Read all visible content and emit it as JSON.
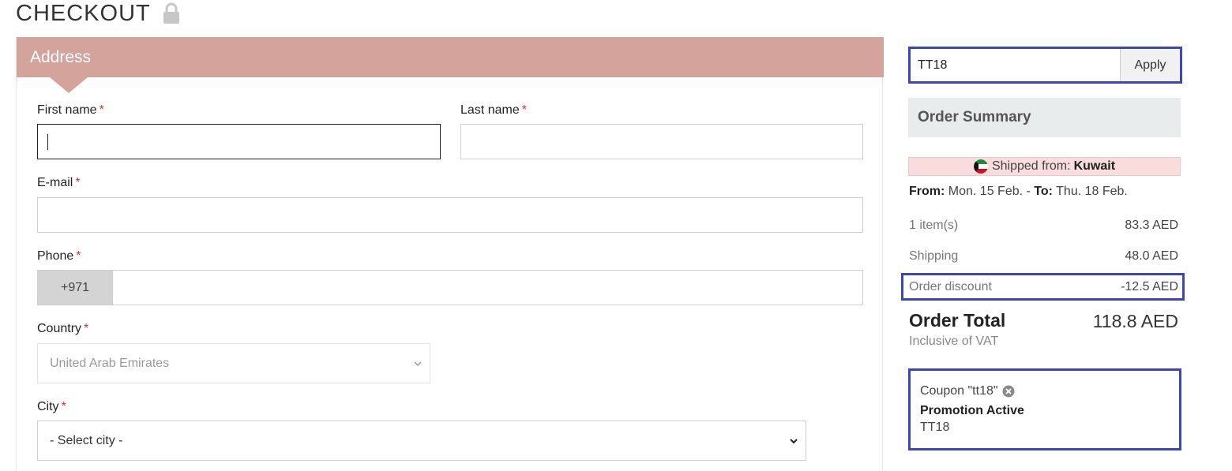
{
  "page": {
    "title": "CHECKOUT",
    "lock_icon": "lock-icon"
  },
  "address": {
    "header": "Address",
    "required_mark": "*",
    "first_name": {
      "label": "First name",
      "value": ""
    },
    "last_name": {
      "label": "Last name",
      "value": ""
    },
    "email": {
      "label": "E-mail",
      "value": ""
    },
    "phone": {
      "label": "Phone",
      "prefix": "+971",
      "value": ""
    },
    "country": {
      "label": "Country",
      "selected": "United Arab Emirates"
    },
    "city": {
      "label": "City",
      "selected": "- Select city -"
    }
  },
  "coupon": {
    "code_value": "TT18",
    "apply_label": "Apply"
  },
  "summary": {
    "header": "Order Summary",
    "shipped_from_label": "Shipped from:",
    "shipped_from_country": "Kuwait",
    "from_label": "From:",
    "from_date": "Mon. 15 Feb.",
    "separator": "-",
    "to_label": "To:",
    "to_date": "Thu. 18 Feb.",
    "items_label": "1 item(s)",
    "items_value": "83.3 AED",
    "shipping_label": "Shipping",
    "shipping_value": "48.0 AED",
    "discount_label": "Order discount",
    "discount_value": "-12.5 AED",
    "total_label": "Order Total",
    "total_value": "118.8 AED",
    "vat_note": "Inclusive of VAT"
  },
  "promotion": {
    "coupon_text": "Coupon \"tt18\"",
    "title": "Promotion Active",
    "code": "TT18"
  },
  "colors": {
    "accent_header": "#d4a39c",
    "highlight_border": "#3b47b8",
    "required": "#c0392b",
    "shipped_bg": "#f9dcdc"
  }
}
